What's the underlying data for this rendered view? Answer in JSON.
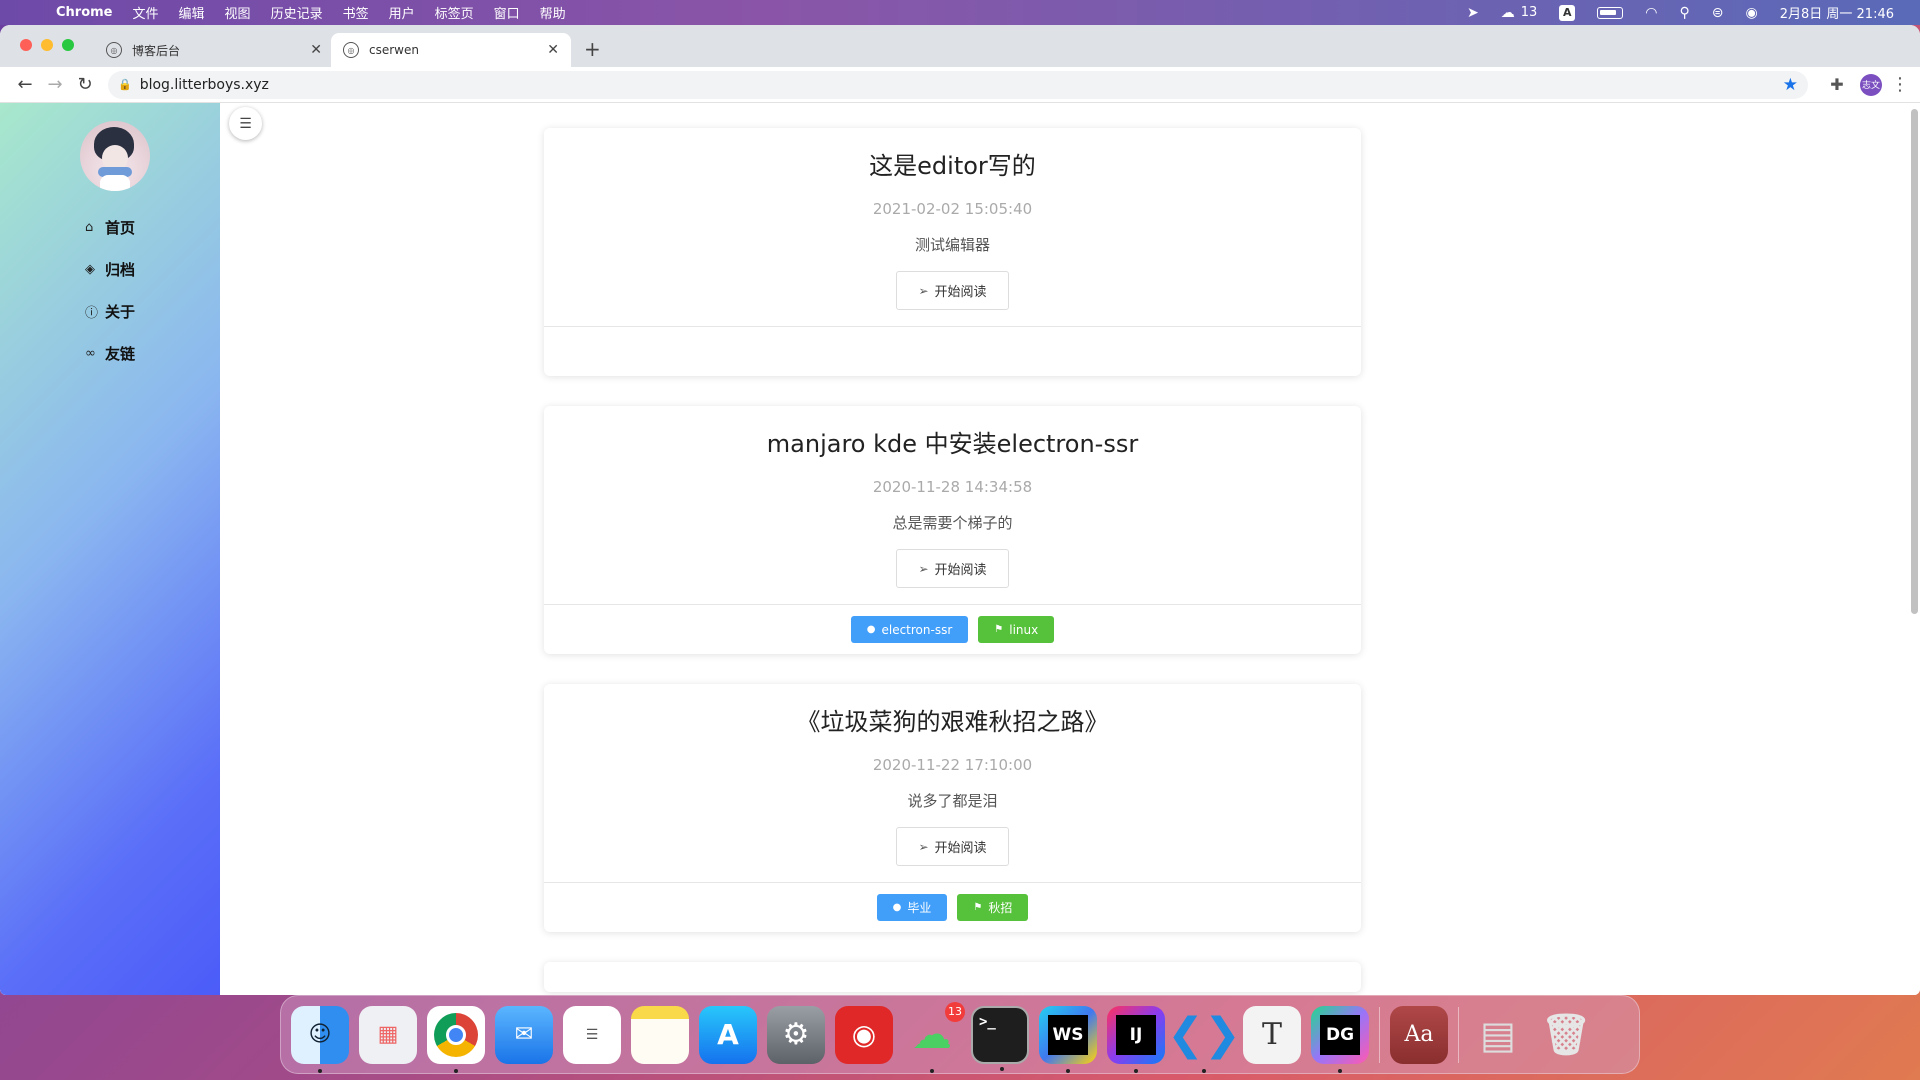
{
  "menubar": {
    "app_name": "Chrome",
    "menus": [
      "文件",
      "编辑",
      "视图",
      "历史记录",
      "书签",
      "用户",
      "标签页",
      "窗口",
      "帮助"
    ],
    "wechat_count": "13",
    "ime_label": "A",
    "datetime": "2月8日 周一 21:46"
  },
  "browser": {
    "tabs": [
      {
        "title": "博客后台",
        "active": false
      },
      {
        "title": "cserwen",
        "active": true
      }
    ],
    "url": "blog.litterboys.xyz",
    "profile_label": "志文"
  },
  "sidebar": {
    "nav": [
      {
        "label": "首页",
        "icon": "home-icon"
      },
      {
        "label": "归档",
        "icon": "layers-icon"
      },
      {
        "label": "关于",
        "icon": "info-icon"
      },
      {
        "label": "友链",
        "icon": "link-icon"
      }
    ]
  },
  "posts": [
    {
      "title": "这是editor写的",
      "date": "2021-02-02 15:05:40",
      "summary": "测试编辑器",
      "read_label": "开始阅读",
      "tags": []
    },
    {
      "title": "manjaro kde 中安装electron-ssr",
      "date": "2020-11-28 14:34:58",
      "summary": "总是需要个梯子的",
      "read_label": "开始阅读",
      "tags": [
        {
          "label": "electron-ssr",
          "color": "#419ffa"
        },
        {
          "label": "linux",
          "color": "#56c13a"
        }
      ]
    },
    {
      "title": "《垃圾菜狗的艰难秋招之路》",
      "date": "2020-11-22 17:10:00",
      "summary": "说多了都是泪",
      "read_label": "开始阅读",
      "tags": [
        {
          "label": "毕业",
          "color": "#419ffa"
        },
        {
          "label": "秋招",
          "color": "#56c13a"
        }
      ]
    }
  ],
  "dock": {
    "wechat_badge": "13",
    "webstorm_label": "WS",
    "idea_label": "IJ",
    "datagrip_label": "DG",
    "typora_label": "T",
    "dictionary_label": "Aa"
  }
}
